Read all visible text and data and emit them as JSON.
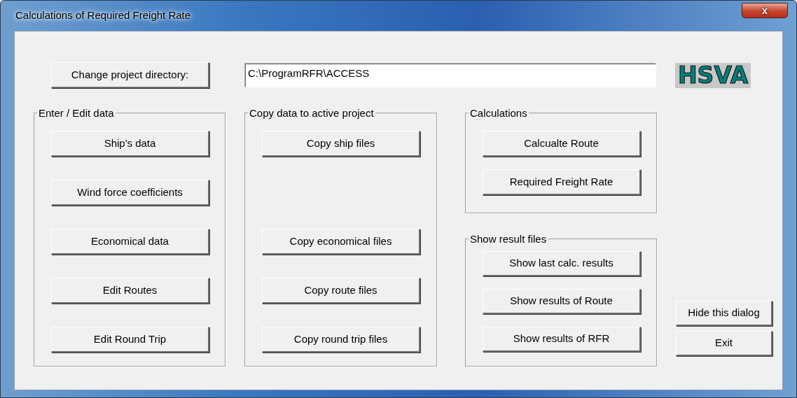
{
  "window": {
    "title": "Calculations of Required Freight Rate",
    "close": "x"
  },
  "project_directory": {
    "button": "Change project directory:",
    "value": "C:\\ProgramRFR\\ACCESS"
  },
  "logo": {
    "text": "HSVA"
  },
  "groups": [
    {
      "kind": "edit",
      "title": "Enter / Edit data",
      "buttons": [
        "Ship's data",
        "Wind force coefficients",
        "Economical data",
        "Edit Routes",
        "Edit Round Trip"
      ]
    },
    {
      "kind": "copy",
      "title": "Copy data to active project",
      "buttons": [
        "Copy ship files",
        "Copy economical files",
        "Copy route files",
        "Copy round trip files"
      ]
    },
    {
      "kind": "calc",
      "title": "Calculations",
      "buttons": [
        "Calcualte Route",
        "Required Freight Rate"
      ]
    },
    {
      "kind": "results",
      "title": "Show result files",
      "buttons": [
        "Show last calc. results",
        "Show results of Route",
        "Show results of RFR"
      ]
    }
  ],
  "side_buttons": [
    "Hide this dialog",
    "Exit"
  ]
}
